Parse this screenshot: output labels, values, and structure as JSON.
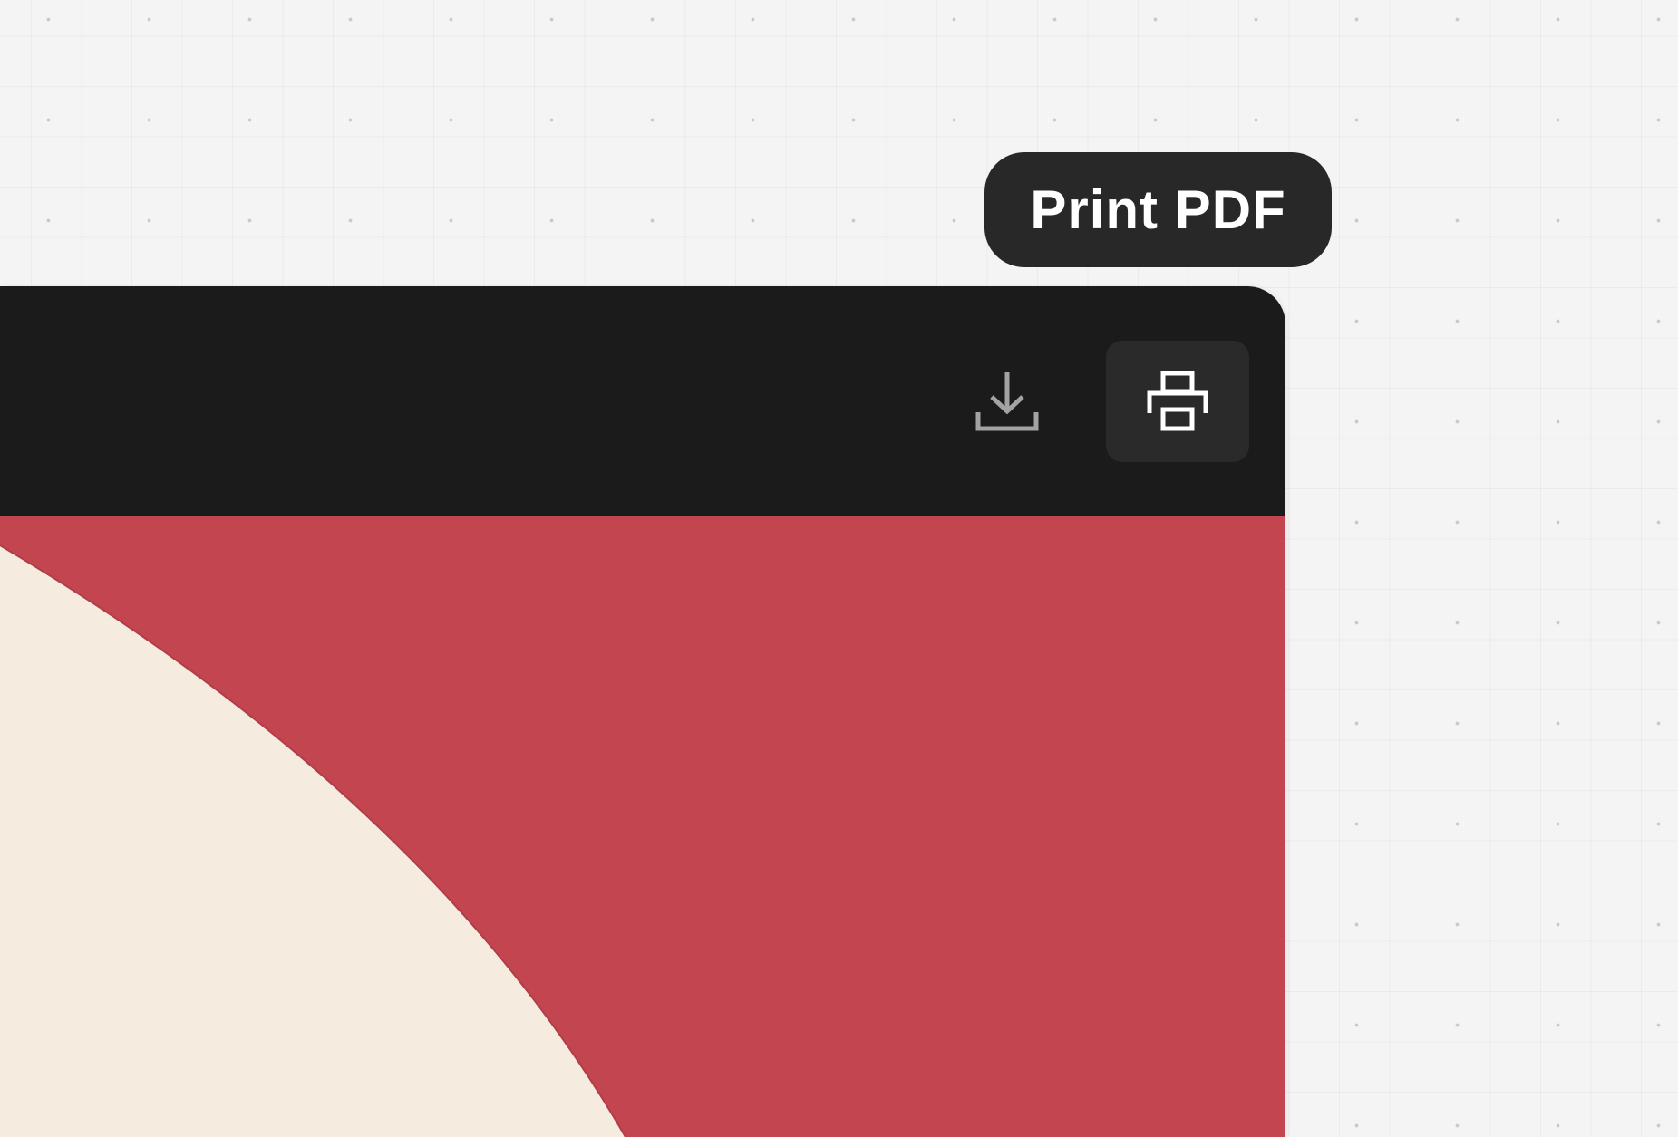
{
  "tooltip": {
    "label": "Print PDF"
  },
  "toolbar": {
    "download_icon": "download-icon",
    "print_icon": "printer-icon"
  },
  "colors": {
    "background": "#f4f4f4",
    "toolbar": "#1b1b1b",
    "tooltip": "#282828",
    "print_button": "#2a2a2a",
    "download_icon": "#a3a3a3",
    "print_icon": "#ffffff",
    "artwork_red": "#c24550",
    "artwork_cream": "#f6ebdf"
  }
}
